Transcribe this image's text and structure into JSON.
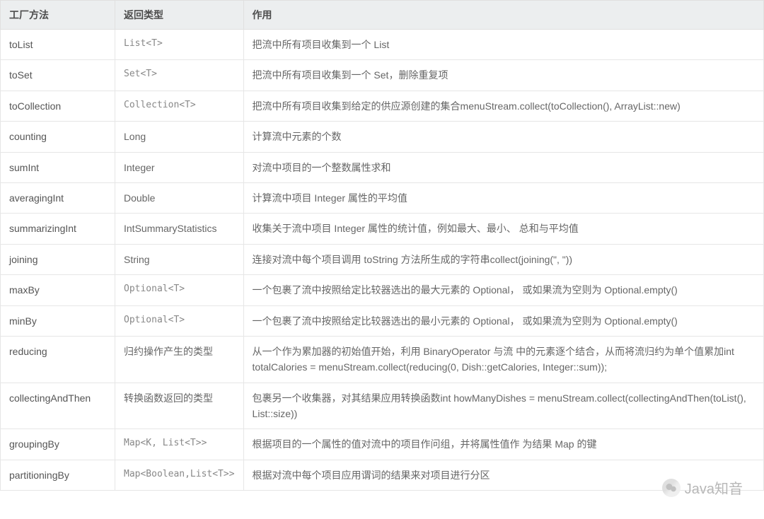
{
  "headers": {
    "method": "工厂方法",
    "return_type": "返回类型",
    "description": "作用"
  },
  "rows": [
    {
      "method": "toList",
      "type": "List<T>",
      "type_mono": true,
      "desc": "把流中所有项目收集到一个 List"
    },
    {
      "method": "toSet",
      "type": "Set<T>",
      "type_mono": true,
      "desc": "把流中所有项目收集到一个 Set，删除重复项"
    },
    {
      "method": "toCollection",
      "type": "Collection<T>",
      "type_mono": true,
      "desc": "把流中所有项目收集到给定的供应源创建的集合menuStream.collect(toCollection(), ArrayList::new)"
    },
    {
      "method": "counting",
      "type": "Long",
      "type_mono": false,
      "desc": "计算流中元素的个数"
    },
    {
      "method": "sumInt",
      "type": "Integer",
      "type_mono": false,
      "desc": "对流中项目的一个整数属性求和"
    },
    {
      "method": "averagingInt",
      "type": "Double",
      "type_mono": false,
      "desc": "计算流中项目 Integer 属性的平均值"
    },
    {
      "method": "summarizingInt",
      "type": "IntSummaryStatistics",
      "type_mono": false,
      "desc": "收集关于流中项目 Integer 属性的统计值，例如最大、最小、 总和与平均值"
    },
    {
      "method": "joining",
      "type": "String",
      "type_mono": false,
      "desc": "连接对流中每个项目调用 toString 方法所生成的字符串collect(joining(\", \"))"
    },
    {
      "method": "maxBy",
      "type": "Optional<T>",
      "type_mono": true,
      "desc": "一个包裹了流中按照给定比较器选出的最大元素的 Optional， 或如果流为空则为 Optional.empty()"
    },
    {
      "method": "minBy",
      "type": "Optional<T>",
      "type_mono": true,
      "desc": "一个包裹了流中按照给定比较器选出的最小元素的 Optional， 或如果流为空则为 Optional.empty()"
    },
    {
      "method": "reducing",
      "type": "归约操作产生的类型",
      "type_mono": false,
      "desc": "从一个作为累加器的初始值开始，利用 BinaryOperator 与流 中的元素逐个结合，从而将流归约为单个值累加int totalCalories = menuStream.collect(reducing(0, Dish::getCalories, Integer::sum));"
    },
    {
      "method": "collectingAndThen",
      "type": "转换函数返回的类型",
      "type_mono": false,
      "desc": "包裹另一个收集器，对其结果应用转换函数int howManyDishes = menuStream.collect(collectingAndThen(toList(), List::size))"
    },
    {
      "method": "groupingBy",
      "type": "Map<K, List<T>>",
      "type_mono": true,
      "desc": "根据项目的一个属性的值对流中的项目作问组，并将属性值作 为结果 Map 的键"
    },
    {
      "method": "partitioningBy",
      "type": "Map<Boolean,List<T>>",
      "type_mono": true,
      "desc": "根据对流中每个项目应用谓词的结果来对项目进行分区"
    }
  ],
  "watermark": {
    "text": "Java知音",
    "icon": "wechat"
  }
}
